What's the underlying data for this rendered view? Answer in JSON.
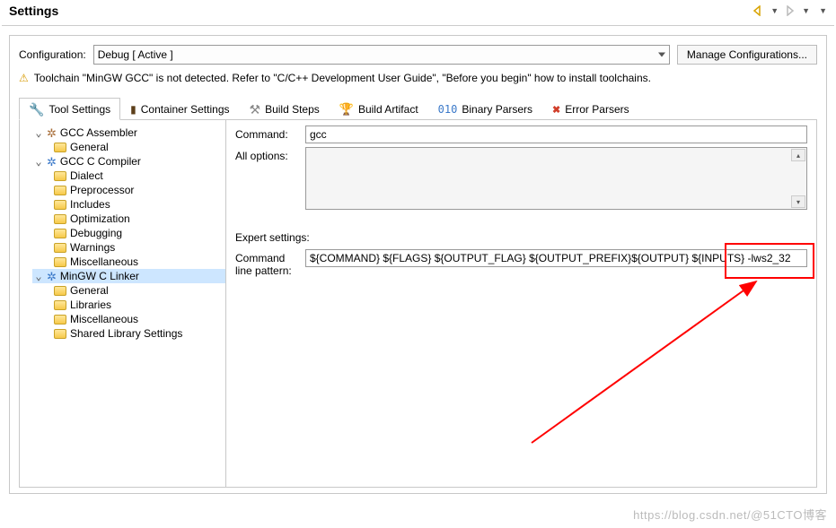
{
  "title": "Settings",
  "config": {
    "label": "Configuration:",
    "value": "Debug  [ Active ]",
    "manage_btn": "Manage Configurations..."
  },
  "warning": "Toolchain \"MinGW GCC\" is not detected. Refer to \"C/C++ Development User Guide\", \"Before you begin\" how to install toolchains.",
  "tabs": {
    "tool_settings": "Tool Settings",
    "container_settings": "Container Settings",
    "build_steps": "Build Steps",
    "build_artifact": "Build Artifact",
    "binary_parsers": "Binary Parsers",
    "error_parsers": "Error Parsers"
  },
  "tree": {
    "assembler": "GCC Assembler",
    "asm_general": "General",
    "compiler": "GCC C Compiler",
    "comp_dialect": "Dialect",
    "comp_preproc": "Preprocessor",
    "comp_includes": "Includes",
    "comp_opt": "Optimization",
    "comp_debug": "Debugging",
    "comp_warn": "Warnings",
    "comp_misc": "Miscellaneous",
    "linker": "MinGW C Linker",
    "link_general": "General",
    "link_libs": "Libraries",
    "link_misc": "Miscellaneous",
    "link_shared": "Shared Library Settings"
  },
  "form": {
    "command_label": "Command:",
    "command_value": "gcc",
    "allopts_label": "All options:",
    "expert_label": "Expert settings:",
    "pattern_label_1": "Command",
    "pattern_label_2": "line pattern:",
    "pattern_value": "${COMMAND} ${FLAGS} ${OUTPUT_FLAG} ${OUTPUT_PREFIX}${OUTPUT} ${INPUTS} -lws2_32"
  },
  "watermark": "https://blog.csdn.net/@51CTO博客"
}
